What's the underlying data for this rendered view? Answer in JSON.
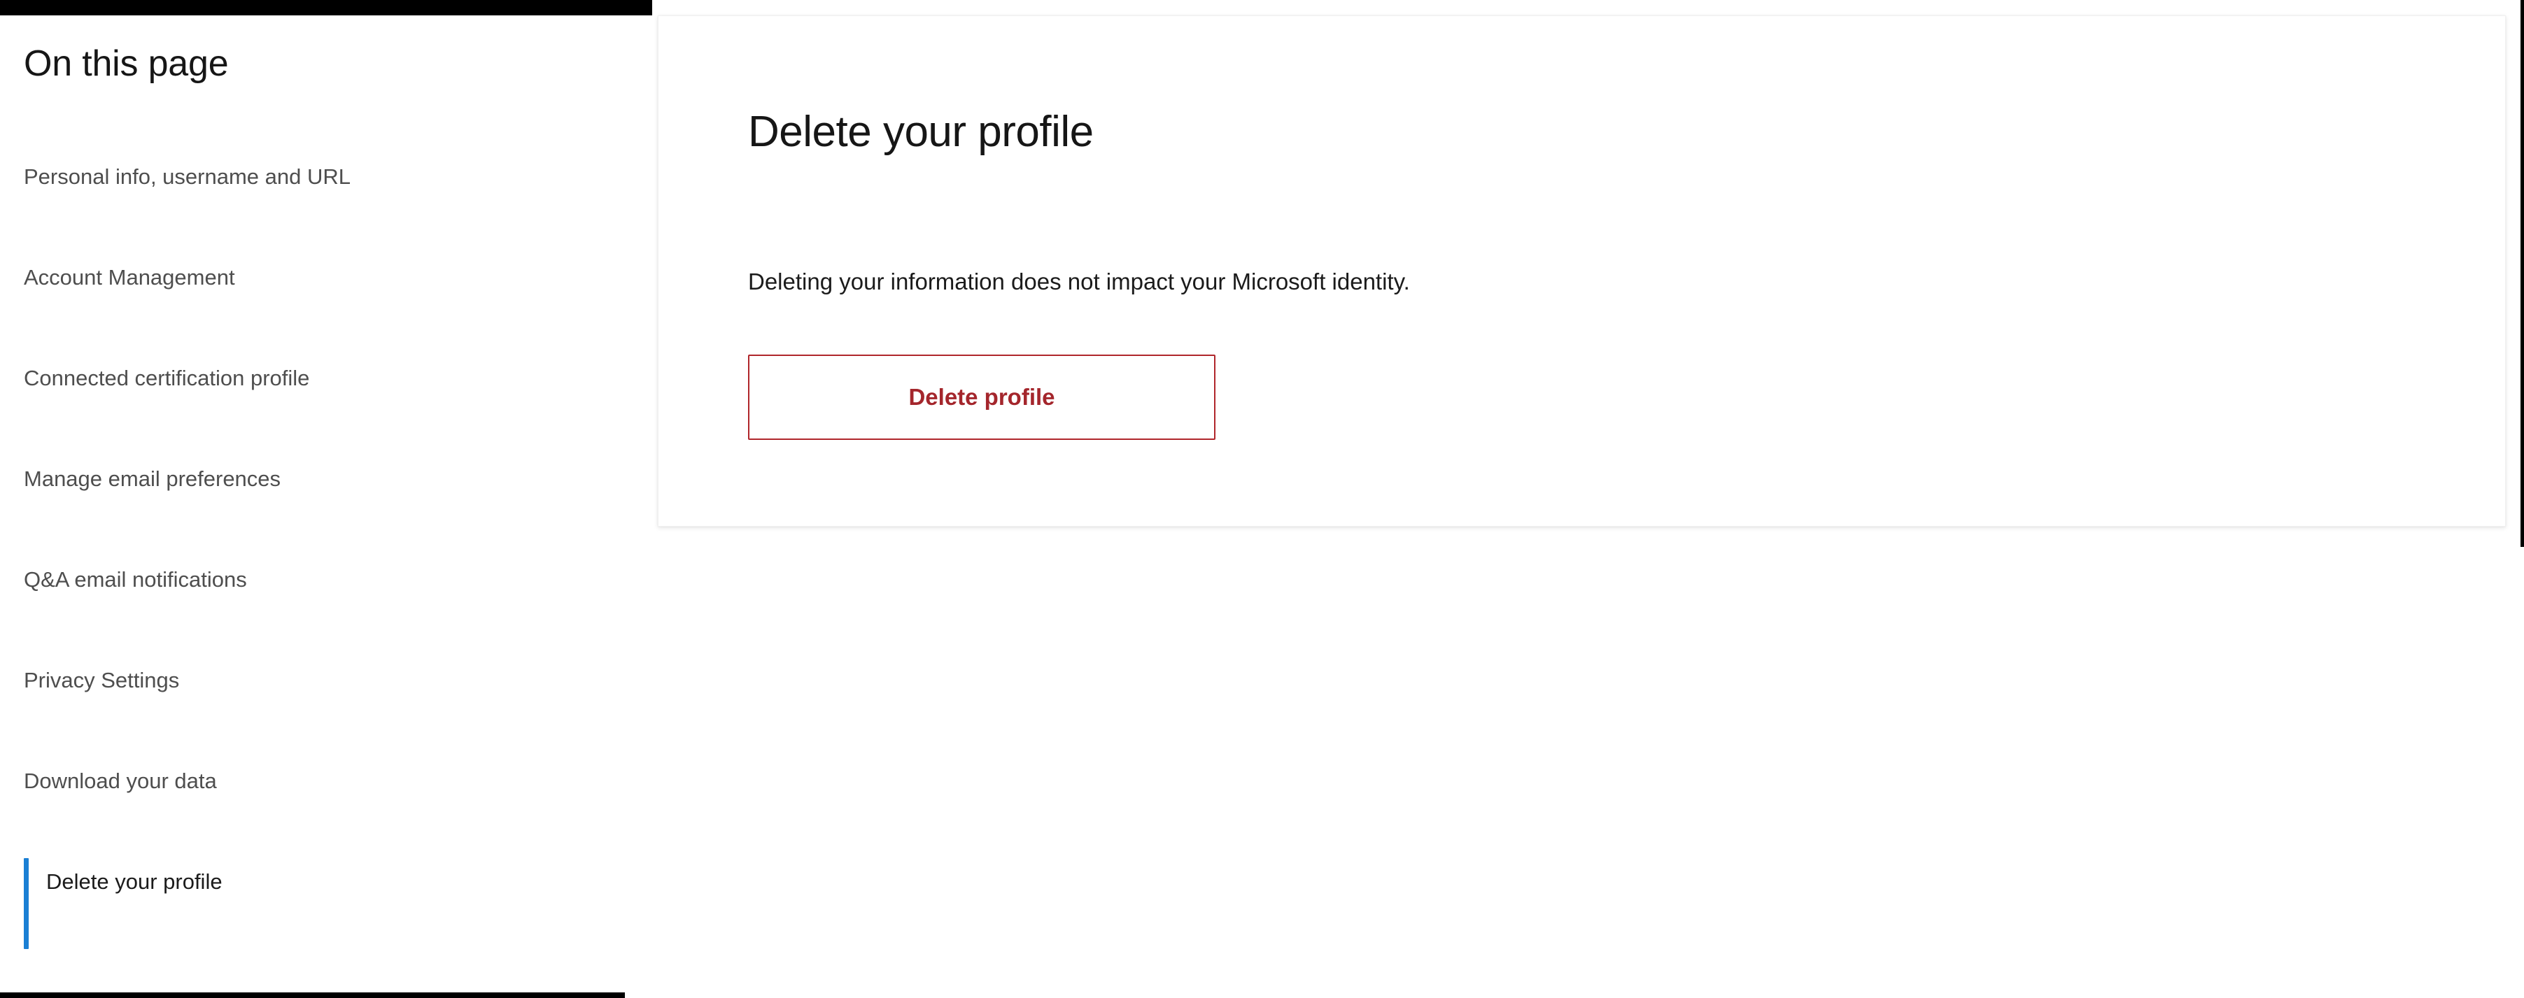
{
  "colors": {
    "accent_blue": "#1a7fd4",
    "danger_red": "#a4262c",
    "danger_border": "#b0262b",
    "text_primary": "#161616",
    "text_secondary": "#4e4e4e",
    "chrome_black": "#000000",
    "panel_background": "#ffffff"
  },
  "sidebar": {
    "title": "On this page",
    "items": [
      {
        "label": "Personal info, username and URL",
        "selected": false
      },
      {
        "label": "Account Management",
        "selected": false
      },
      {
        "label": "Connected certification profile",
        "selected": false
      },
      {
        "label": "Manage email preferences",
        "selected": false
      },
      {
        "label": "Q&A email notifications",
        "selected": false
      },
      {
        "label": "Privacy Settings",
        "selected": false
      },
      {
        "label": "Download your data",
        "selected": false
      },
      {
        "label": "Delete your profile",
        "selected": true
      }
    ]
  },
  "main": {
    "title": "Delete your profile",
    "description": "Deleting your information does not impact your Microsoft identity.",
    "delete_button_label": "Delete profile"
  }
}
